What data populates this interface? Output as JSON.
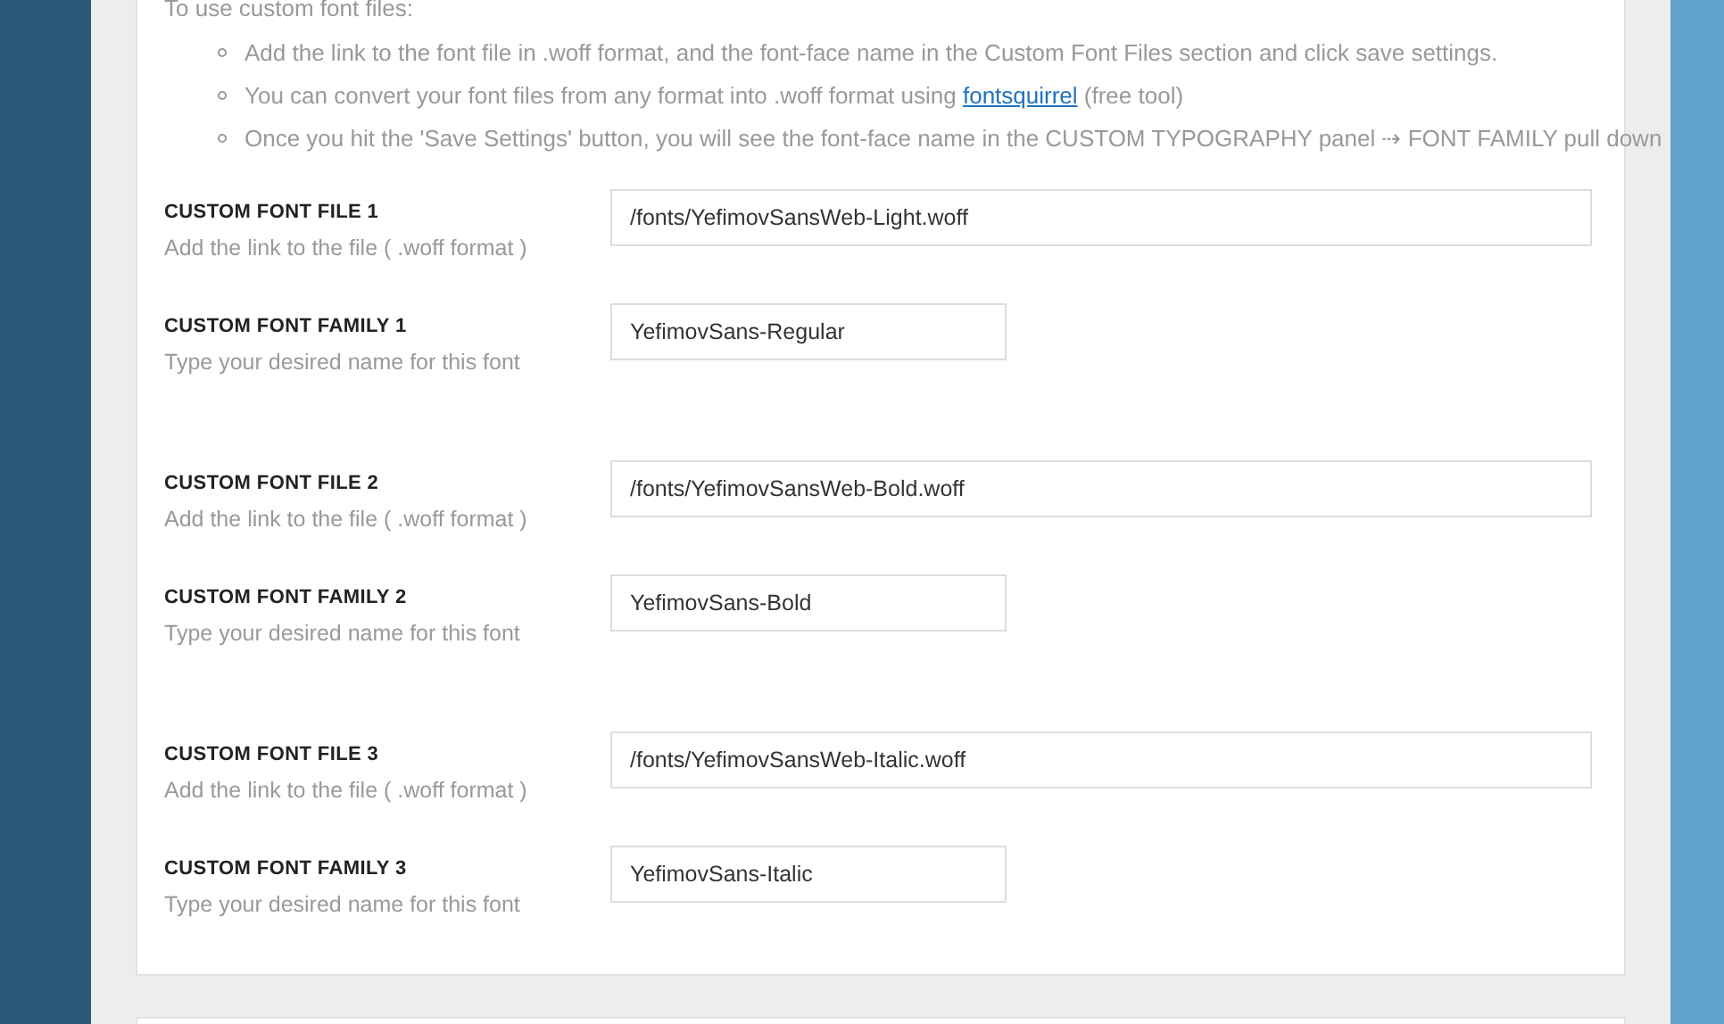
{
  "intro": "To use custom font files:",
  "bullets": [
    {
      "segments": [
        {
          "kind": "text",
          "text": "Add the link to the font file in .woff format, and the font-face name in the Custom Font Files section and click save settings."
        }
      ]
    },
    {
      "segments": [
        {
          "kind": "text",
          "text": "You can convert your font files from any format into .woff format using "
        },
        {
          "kind": "link",
          "text": "fontsquirrel"
        },
        {
          "kind": "text",
          "text": " (free tool)"
        }
      ]
    },
    {
      "segments": [
        {
          "kind": "text",
          "text": "Once you hit the 'Save Settings' button, you will see the font-face name in the CUSTOM TYPOGRAPHY panel ⇢ FONT FAMILY pull down"
        }
      ]
    }
  ],
  "groups": [
    {
      "fields": [
        {
          "kind": "wide",
          "label": "CUSTOM FONT FILE 1",
          "hint": "Add the link to the file ( .woff format )",
          "value": "/fonts/YefimovSansWeb-Light.woff"
        },
        {
          "kind": "short",
          "label": "CUSTOM FONT FAMILY 1",
          "hint": "Type your desired name for this font",
          "value": "YefimovSans-Regular"
        }
      ]
    },
    {
      "fields": [
        {
          "kind": "wide",
          "label": "CUSTOM FONT FILE 2",
          "hint": "Add the link to the file ( .woff format )",
          "value": "/fonts/YefimovSansWeb-Bold.woff"
        },
        {
          "kind": "short",
          "label": "CUSTOM FONT FAMILY 2",
          "hint": "Type your desired name for this font",
          "value": "YefimovSans-Bold"
        }
      ]
    },
    {
      "fields": [
        {
          "kind": "wide",
          "label": "CUSTOM FONT FILE 3",
          "hint": "Add the link to the file ( .woff format )",
          "value": "/fonts/YefimovSansWeb-Italic.woff"
        },
        {
          "kind": "short",
          "label": "CUSTOM FONT FAMILY 3",
          "hint": "Type your desired name for this font",
          "value": "YefimovSans-Italic"
        }
      ]
    }
  ]
}
